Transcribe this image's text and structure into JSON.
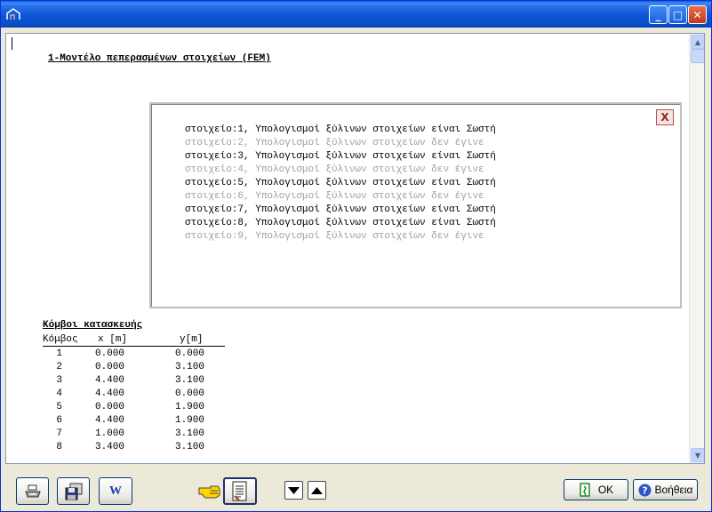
{
  "window": {
    "app_icon": "house-outline-icon",
    "controls": {
      "minimize": "_",
      "maximize": "□",
      "close": "✕"
    }
  },
  "document": {
    "title": "1-Μοντέλο πεπερασμένων στοιχείων (FEM)",
    "message_box": {
      "close_label": "X",
      "lines": [
        {
          "text": "στοιχείο:1, Υπολογισμοί ξύλινων στοιχείων είναι Σωστή",
          "status": "ok"
        },
        {
          "text": "στοιχείο:2, Υπολογισμοί ξύλινων στοιχείων δεν έγινε",
          "status": "no"
        },
        {
          "text": "στοιχείο:3, Υπολογισμοί ξύλινων στοιχείων είναι Σωστή",
          "status": "ok"
        },
        {
          "text": "στοιχείο:4, Υπολογισμοί ξύλινων στοιχείων δεν έγινε",
          "status": "no"
        },
        {
          "text": "στοιχείο:5, Υπολογισμοί ξύλινων στοιχείων είναι Σωστή",
          "status": "ok"
        },
        {
          "text": "στοιχείο:6, Υπολογισμοί ξύλινων στοιχείων δεν έγινε",
          "status": "no"
        },
        {
          "text": "στοιχείο:7, Υπολογισμοί ξύλινων στοιχείων είναι Σωστή",
          "status": "ok"
        },
        {
          "text": "στοιχείο:8, Υπολογισμοί ξύλινων στοιχείων είναι Σωστή",
          "status": "ok"
        },
        {
          "text": "στοιχείο:9, Υπολογισμοί ξύλινων στοιχείων δεν έγινε",
          "status": "no"
        }
      ]
    },
    "nodes": {
      "title": "Κόμβοι κατασκευής",
      "headers": [
        "Κόμβος",
        "x [m]",
        "y[m]"
      ],
      "rows": [
        [
          "1",
          "0.000",
          "0.000"
        ],
        [
          "2",
          "0.000",
          "3.100"
        ],
        [
          "3",
          "4.400",
          "3.100"
        ],
        [
          "4",
          "4.400",
          "0.000"
        ],
        [
          "5",
          "0.000",
          "1.900"
        ],
        [
          "6",
          "4.400",
          "1.900"
        ],
        [
          "7",
          "1.000",
          "3.100"
        ],
        [
          "8",
          "3.400",
          "3.100"
        ]
      ]
    }
  },
  "toolbar": {
    "print_icon": "printer-icon",
    "save_icon": "save-disk-icon",
    "word_label": "W",
    "pointer_icon": "pointing-hand-icon",
    "report_icon": "report-document-icon",
    "ok_label": "OK",
    "help_label": "Βοήθεια"
  },
  "colors": {
    "titlebar": "#0a4ec9",
    "ok_line": "#000000",
    "failed_line": "#a0a0a0",
    "close_x": "#c0504d"
  }
}
